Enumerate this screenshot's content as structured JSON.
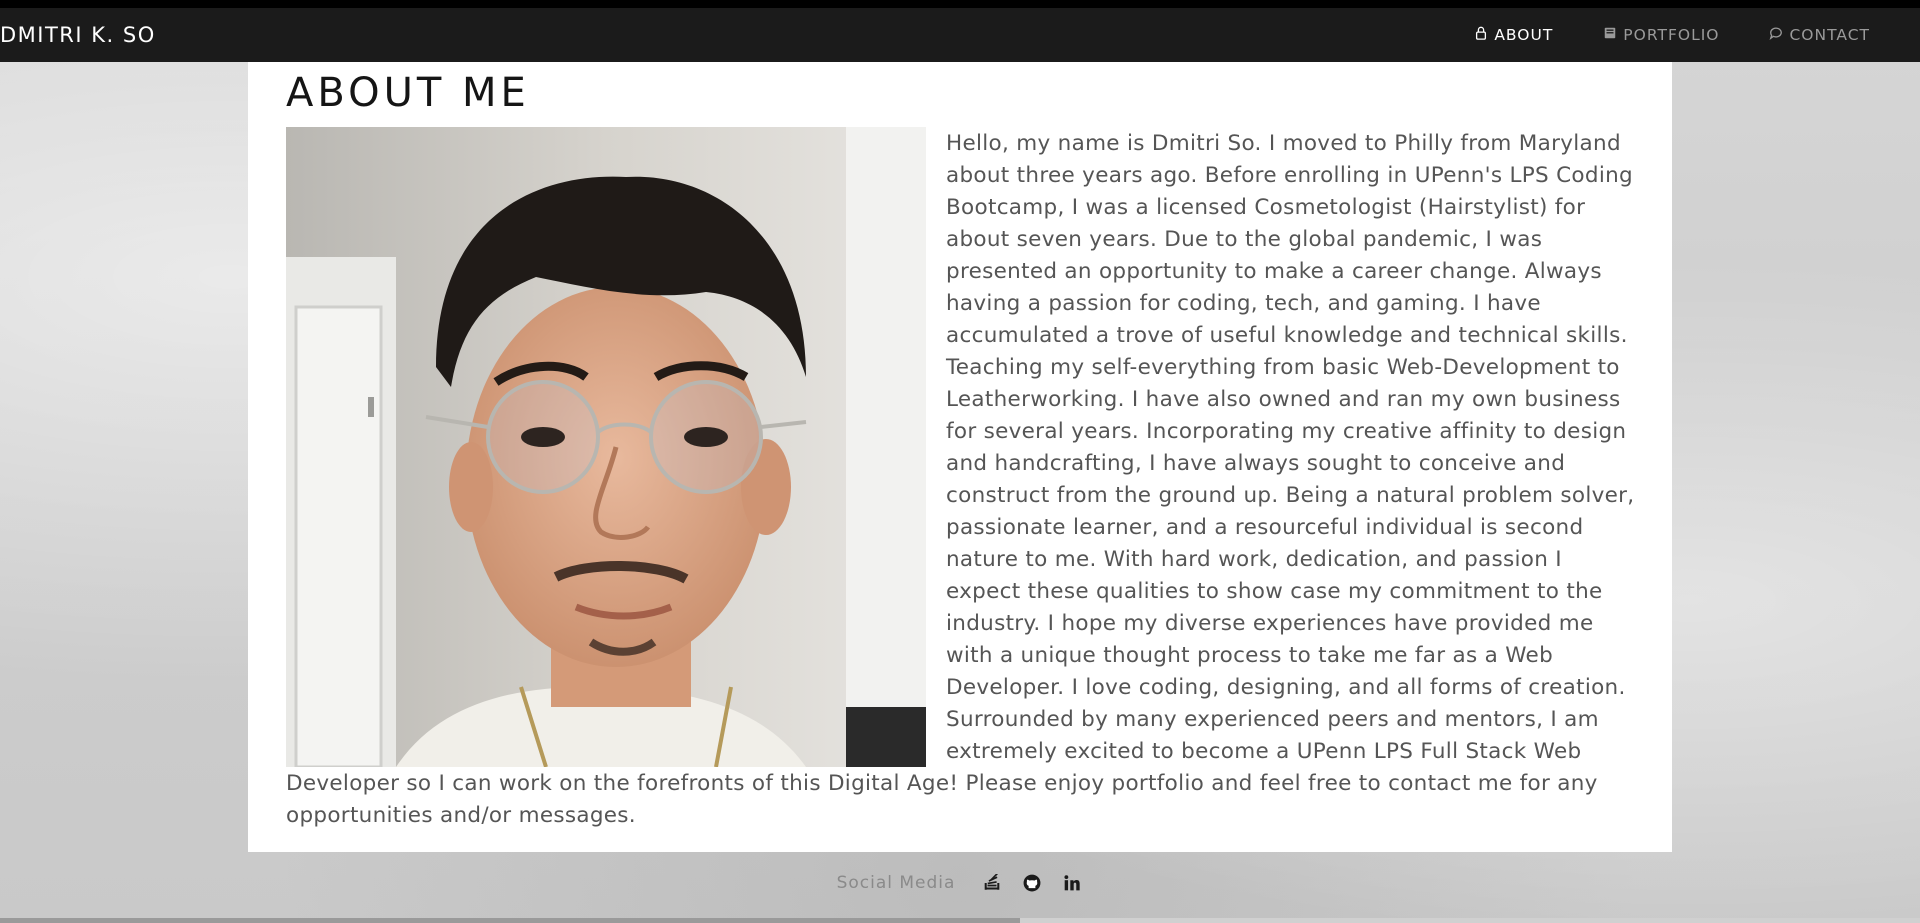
{
  "navbar": {
    "brand": "DMITRI K. SO",
    "links": [
      {
        "label": "ABOUT",
        "icon": "person-icon",
        "active": true
      },
      {
        "label": "PORTFOLIO",
        "icon": "book-icon",
        "active": false
      },
      {
        "label": "CONTACT",
        "icon": "chat-bubble-icon",
        "active": false
      }
    ]
  },
  "about": {
    "title": "ABOUT ME",
    "bio": "Hello, my name is Dmitri So. I moved to Philly from Maryland about three years ago. Before enrolling in UPenn's LPS Coding Bootcamp, I was a licensed Cosmetologist (Hairstylist) for about seven years. Due to the global pandemic, I was presented an opportunity to make a career change. Always having a passion for coding, tech, and gaming. I have accumulated a trove of useful knowledge and technical skills. Teaching my self-everything from basic Web-Development to Leatherworking. I have also owned and ran my own business for several years. Incorporating my creative affinity to design and handcrafting, I have always sought to conceive and construct from the ground up. Being a natural problem solver, passionate learner, and a resourceful individual is second nature to me. With hard work, dedication, and passion I expect these qualities to show case my commitment to the industry. I hope my diverse experiences have provided me with a unique thought process to take me far as a Web Developer. I love coding, designing, and all forms of creation. Surrounded by many experienced peers and mentors, I am extremely excited to become a UPenn LPS Full Stack Web Developer so I can work on the forefronts of this Digital Age! Please enjoy portfolio and feel free to contact me for any opportunities and/or messages."
  },
  "footer": {
    "label": "Social Media",
    "icons": [
      "stack-overflow-icon",
      "github-icon",
      "linkedin-icon"
    ]
  },
  "colors": {
    "navbar_bg": "#1b1b1b",
    "nav_active": "#ffffff",
    "nav_inactive": "#9a9a9a",
    "panel_bg": "#ffffff",
    "text": "#555555"
  }
}
